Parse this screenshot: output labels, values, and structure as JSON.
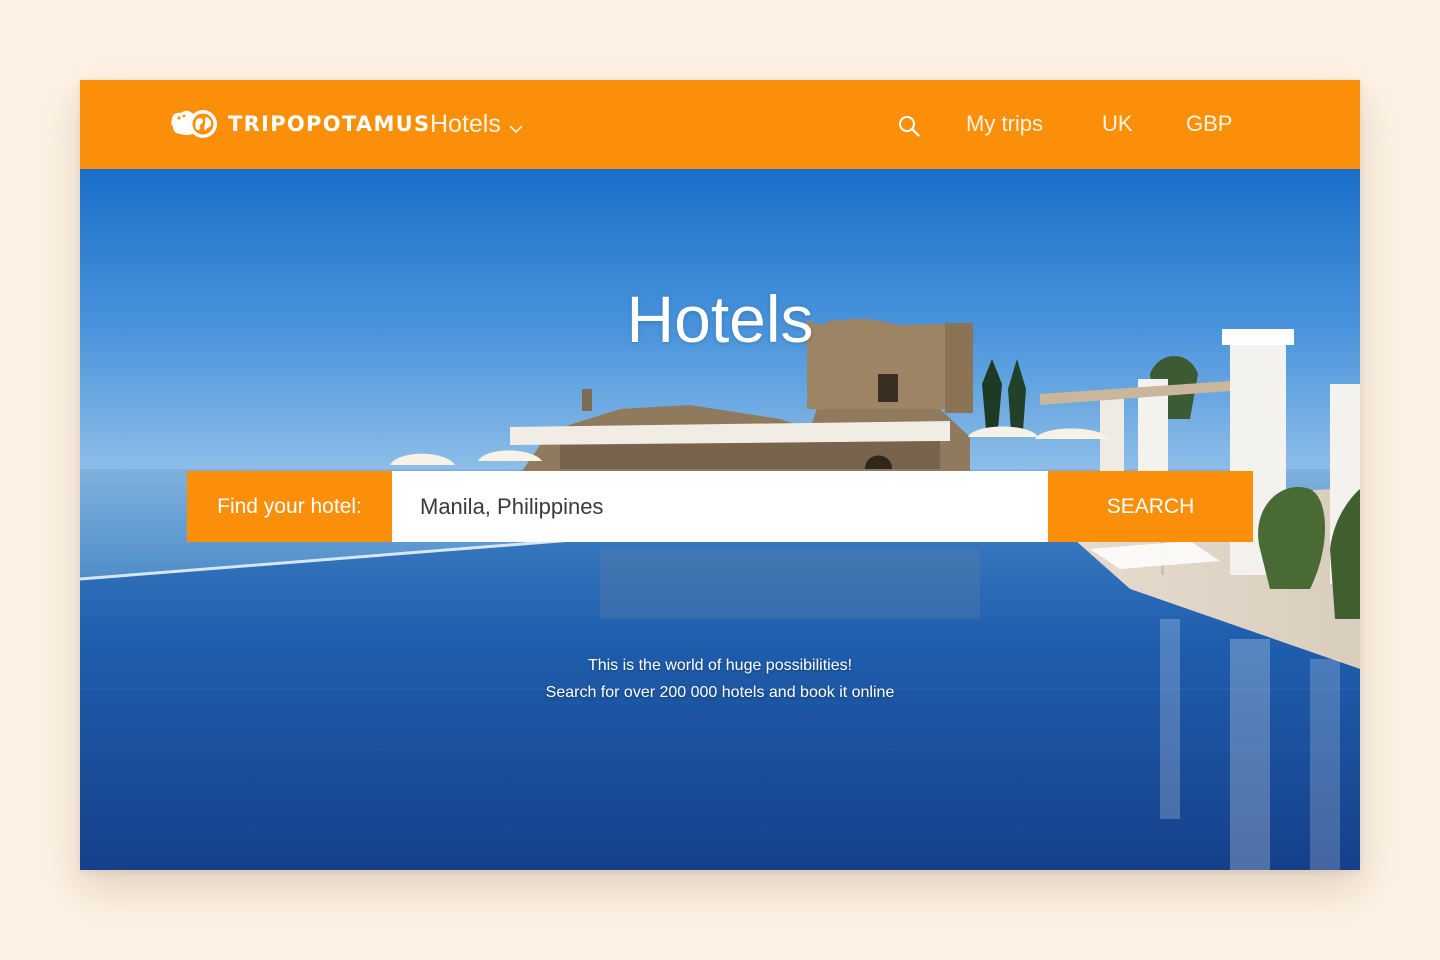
{
  "header": {
    "brand": "TRIPOPOTAMUS",
    "product": "Hotels",
    "nav": {
      "my_trips": "My trips",
      "country": "UK",
      "currency": "GBP"
    }
  },
  "hero": {
    "title": "Hotels",
    "search": {
      "label": "Find your hotel:",
      "value": "Manila, Philippines",
      "button": "SEARCH"
    },
    "tagline_1": "This is the world of huge possibilities!",
    "tagline_2": "Search for over 200 000 hotels and book it online"
  },
  "colors": {
    "accent": "#fb8f0a",
    "page_background": "#fdf2e5"
  }
}
